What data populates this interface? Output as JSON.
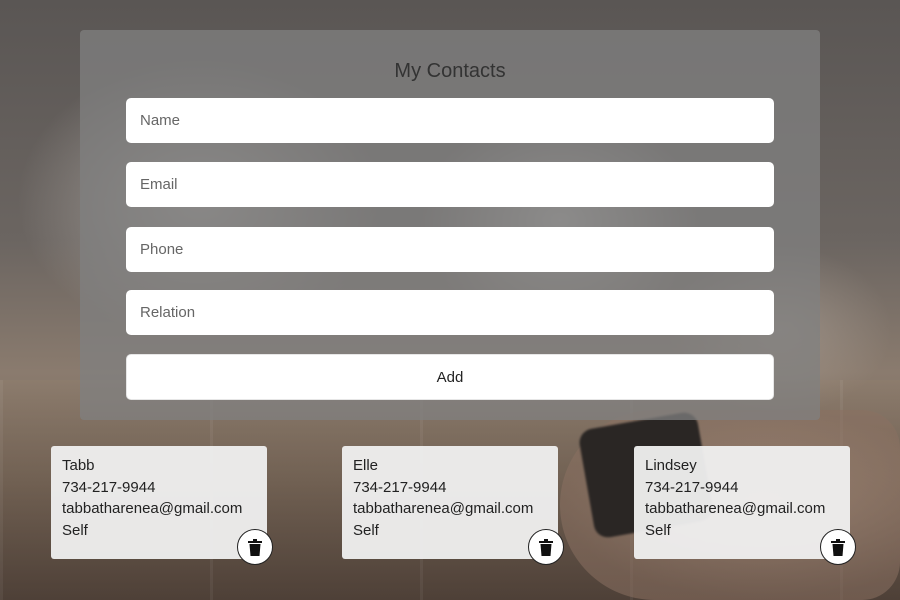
{
  "header": {
    "title": "My Contacts"
  },
  "form": {
    "name_placeholder": "Name",
    "email_placeholder": "Email",
    "phone_placeholder": "Phone",
    "relation_placeholder": "Relation",
    "add_label": "Add"
  },
  "contacts": [
    {
      "name": "Tabb",
      "phone": "734-217-9944",
      "email": "tabbatharenea@gmail.com",
      "relation": "Self",
      "delete_icon": "trash-icon"
    },
    {
      "name": "Elle",
      "phone": "734-217-9944",
      "email": "tabbatharenea@gmail.com",
      "relation": "Self",
      "delete_icon": "trash-icon"
    },
    {
      "name": "Lindsey",
      "phone": "734-217-9944",
      "email": "tabbatharenea@gmail.com",
      "relation": "Self",
      "delete_icon": "trash-icon"
    }
  ]
}
